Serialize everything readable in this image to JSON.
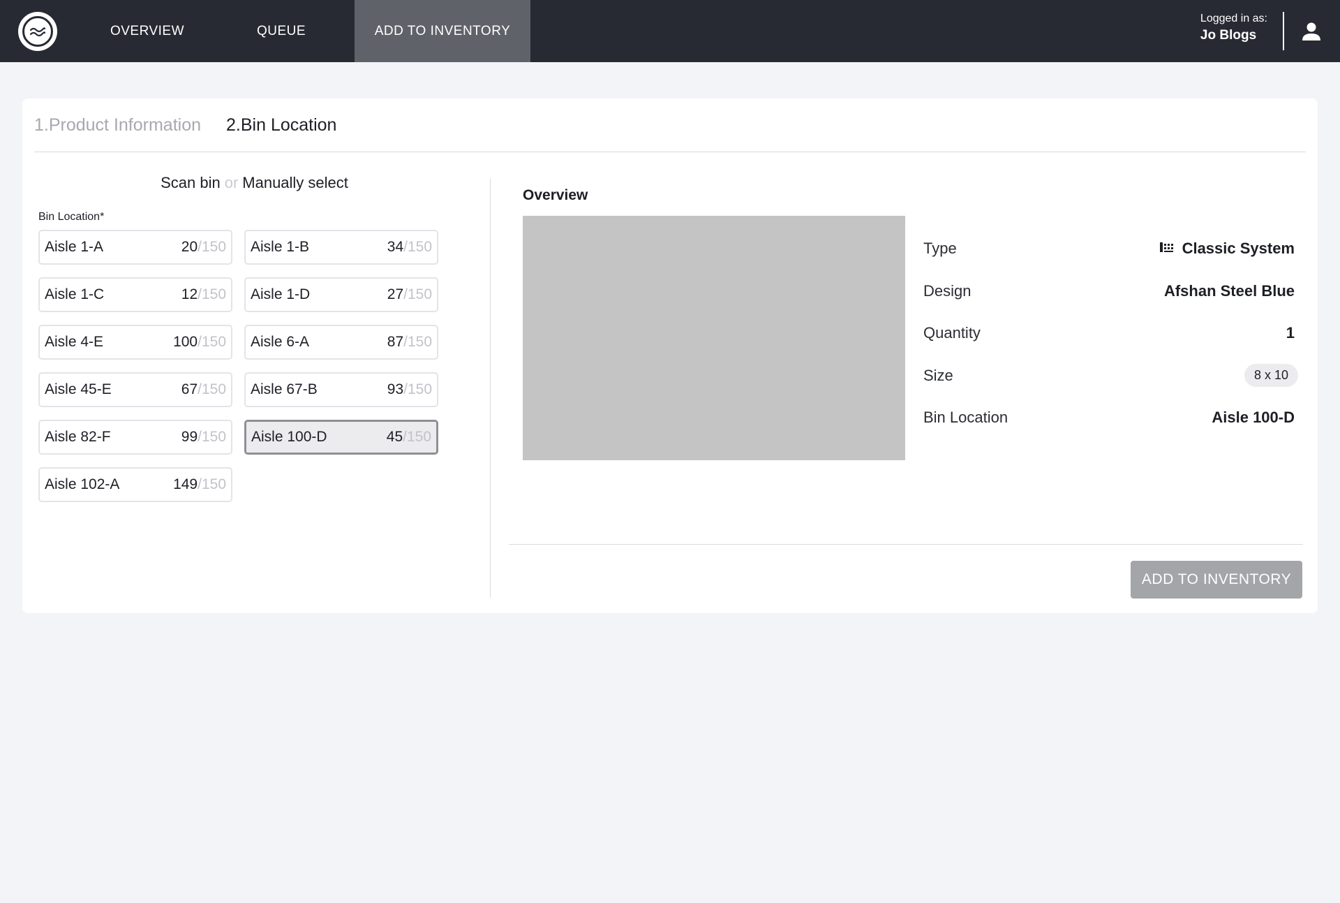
{
  "nav": {
    "items": [
      {
        "label": "OVERVIEW",
        "active": false
      },
      {
        "label": "QUEUE",
        "active": false
      },
      {
        "label": "ADD TO INVENTORY",
        "active": true
      }
    ]
  },
  "user": {
    "logged_in_label": "Logged in as:",
    "name": "Jo Blogs"
  },
  "steps": [
    {
      "label": "1.Product Information",
      "state": "done"
    },
    {
      "label": "2.Bin Location",
      "state": "current"
    }
  ],
  "bin_select": {
    "scan_label": "Scan bin",
    "or_label": "or",
    "manual_label": "Manually select",
    "field_label": "Bin Location*",
    "bins": [
      {
        "name": "Aisle 1-A",
        "count": "20",
        "max": "/150",
        "selected": false
      },
      {
        "name": "Aisle 1-B",
        "count": "34",
        "max": "/150",
        "selected": false
      },
      {
        "name": "Aisle 1-C",
        "count": "12",
        "max": "/150",
        "selected": false
      },
      {
        "name": "Aisle 1-D",
        "count": "27",
        "max": "/150",
        "selected": false
      },
      {
        "name": "Aisle 4-E",
        "count": "100",
        "max": "/150",
        "selected": false
      },
      {
        "name": "Aisle 6-A",
        "count": "87",
        "max": "/150",
        "selected": false
      },
      {
        "name": "Aisle 45-E",
        "count": "67",
        "max": "/150",
        "selected": false
      },
      {
        "name": "Aisle 67-B",
        "count": "93",
        "max": "/150",
        "selected": false
      },
      {
        "name": "Aisle 82-F",
        "count": "99",
        "max": "/150",
        "selected": false
      },
      {
        "name": "Aisle 100-D",
        "count": "45",
        "max": "/150",
        "selected": true
      },
      {
        "name": "Aisle 102-A",
        "count": "149",
        "max": "/150",
        "selected": false
      }
    ]
  },
  "overview": {
    "title": "Overview",
    "type_label": "Type",
    "type_value": "Classic System",
    "type_icon": "system-icon",
    "design_label": "Design",
    "design_value": "Afshan Steel Blue",
    "quantity_label": "Quantity",
    "quantity_value": "1",
    "size_label": "Size",
    "size_value": "8 x 10",
    "bin_label": "Bin Location",
    "bin_value": "Aisle 100-D"
  },
  "actions": {
    "add_label": "ADD TO INVENTORY"
  },
  "colors": {
    "topbar": "#272a33",
    "nav_active": "#60626a",
    "button_disabled": "#a4a5a9",
    "image_placeholder": "#c4c4c4"
  }
}
